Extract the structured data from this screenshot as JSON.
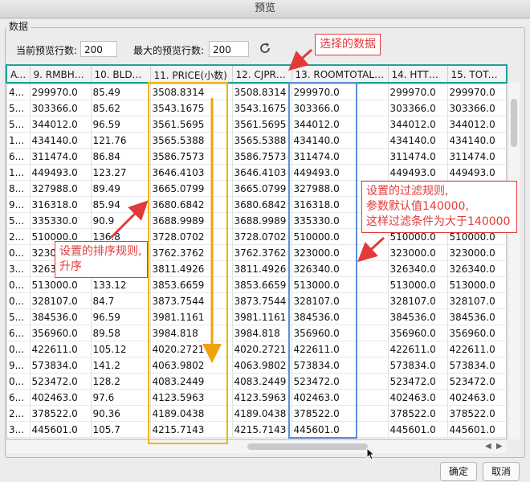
{
  "window": {
    "title": "预览"
  },
  "group": {
    "title": "数据"
  },
  "controls": {
    "current_rows_label": "当前预览行数:",
    "current_rows_value": "200",
    "max_rows_label": "最大的预览行数:",
    "max_rows_value": "200"
  },
  "table": {
    "columns": [
      "AT...",
      "9. RMBHT...",
      "10. BLDA...",
      "11. PRICE(小数)",
      "12. CJPRI...",
      "13. ROOMTOTAL(...",
      "14. HTTO...",
      "15. TOTA..."
    ],
    "rows": [
      [
        "4...",
        "299970.0",
        "85.49",
        "3508.8314",
        "3508.8314",
        "299970.0",
        "299970.0",
        "299970.0"
      ],
      [
        "5...",
        "303366.0",
        "85.62",
        "3543.1675",
        "3543.1675",
        "303366.0",
        "303366.0",
        "303366.0"
      ],
      [
        "5...",
        "344012.0",
        "96.59",
        "3561.5695",
        "3561.5695",
        "344012.0",
        "344012.0",
        "344012.0"
      ],
      [
        "1...",
        "434140.0",
        "121.76",
        "3565.5388",
        "3565.5388",
        "434140.0",
        "434140.0",
        "434140.0"
      ],
      [
        "6...",
        "311474.0",
        "86.84",
        "3586.7573",
        "3586.7573",
        "311474.0",
        "311474.0",
        "311474.0"
      ],
      [
        "1...",
        "449493.0",
        "123.27",
        "3646.4103",
        "3646.4103",
        "449493.0",
        "449493.0",
        "449493.0"
      ],
      [
        "8...",
        "327988.0",
        "89.49",
        "3665.0799",
        "3665.0799",
        "327988.0",
        "327988.0",
        "327988.0"
      ],
      [
        "9...",
        "316318.0",
        "85.94",
        "3680.6842",
        "3680.6842",
        "316318.0",
        "316318.0",
        "316318.0"
      ],
      [
        "5...",
        "335330.0",
        "90.9",
        "3688.9989",
        "3688.9989",
        "335330.0",
        "335330.0",
        "335330.0"
      ],
      [
        "2...",
        "510000.0",
        "136.8",
        "3728.0702",
        "3728.0702",
        "510000.0",
        "510000.0",
        "510000.0"
      ],
      [
        "0...",
        "323000.0",
        "85.7",
        "3762.3762",
        "3762.3762",
        "323000.0",
        "323000.0",
        "323000.0"
      ],
      [
        "3...",
        "326340.0",
        "85.62",
        "3811.4926",
        "3811.4926",
        "326340.0",
        "326340.0",
        "326340.0"
      ],
      [
        "0...",
        "513000.0",
        "133.12",
        "3853.6659",
        "3853.6659",
        "513000.0",
        "513000.0",
        "513000.0"
      ],
      [
        "0...",
        "328107.0",
        "84.7",
        "3873.7544",
        "3873.7544",
        "328107.0",
        "328107.0",
        "328107.0"
      ],
      [
        "5...",
        "384536.0",
        "96.59",
        "3981.1161",
        "3981.1161",
        "384536.0",
        "384536.0",
        "384536.0"
      ],
      [
        "6...",
        "356960.0",
        "89.58",
        "3984.818",
        "3984.818",
        "356960.0",
        "356960.0",
        "356960.0"
      ],
      [
        "0...",
        "422611.0",
        "105.12",
        "4020.2721",
        "4020.2721",
        "422611.0",
        "422611.0",
        "422611.0"
      ],
      [
        "9...",
        "573834.0",
        "141.2",
        "4063.9802",
        "4063.9802",
        "573834.0",
        "573834.0",
        "573834.0"
      ],
      [
        "0...",
        "523472.0",
        "128.2",
        "4083.2449",
        "4083.2449",
        "523472.0",
        "523472.0",
        "523472.0"
      ],
      [
        "6...",
        "402463.0",
        "97.6",
        "4123.5963",
        "4123.5963",
        "402463.0",
        "402463.0",
        "402463.0"
      ],
      [
        "2...",
        "378522.0",
        "90.36",
        "4189.0438",
        "4189.0438",
        "378522.0",
        "378522.0",
        "378522.0"
      ],
      [
        "3...",
        "445601.0",
        "105.7",
        "4215.7143",
        "4215.7143",
        "445601.0",
        "445601.0",
        "445601.0"
      ]
    ]
  },
  "annotations": {
    "selected_data": "选择的数据",
    "sort_rule_line1": "设置的排序规则,",
    "sort_rule_line2": "升序",
    "filter_rule_line1": "设置的过滤规则,",
    "filter_rule_line2": "参数默认值140000,",
    "filter_rule_line3": "这样过滤条件为大于140000"
  },
  "buttons": {
    "ok": "确定",
    "cancel": "取消"
  },
  "colors": {
    "header_outline": "#1aa39a",
    "sort_outline": "#f0b400",
    "filter_outline": "#5a8fd8",
    "annotation_red": "#e23a3a",
    "sort_arrow": "#f2a20c"
  }
}
